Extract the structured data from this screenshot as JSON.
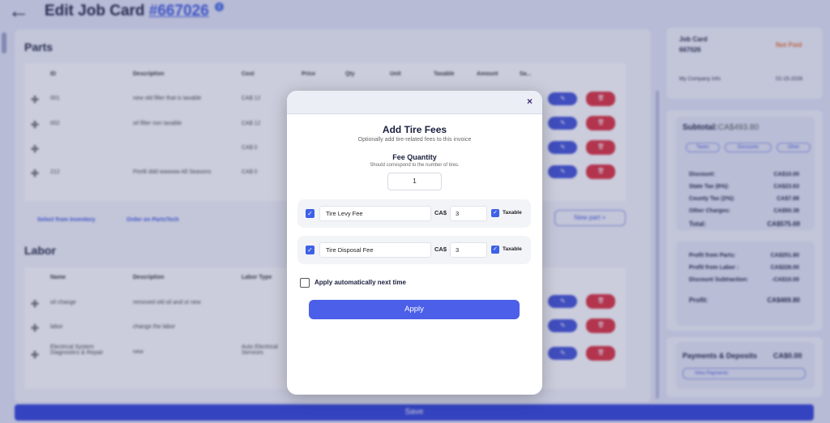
{
  "header": {
    "title": "Edit Job Card",
    "job_number": "#667026",
    "info_glyph": "i"
  },
  "parts": {
    "heading": "Parts",
    "columns": [
      "ID",
      "Description",
      "Cost",
      "Price",
      "Qty",
      "Unit",
      "Taxable",
      "Amount",
      "Sa..."
    ],
    "rows": [
      {
        "id": "001",
        "description": "new old filter that is taxable",
        "cost": "CA$ 12"
      },
      {
        "id": "002",
        "description": "oil filter non taxable",
        "cost": "CA$ 12"
      },
      {
        "id": "",
        "description": "",
        "cost": "CA$ 0"
      },
      {
        "id": "212",
        "description": "Pirelli ddd wwwww All Seasons",
        "cost": "CA$ 0"
      }
    ],
    "select_inventory": "Select from Inventory",
    "order_partstech": "Order on PartsTech",
    "new_part": "New part +"
  },
  "labor": {
    "heading": "Labor",
    "columns": [
      "Name",
      "Description",
      "Labor Type"
    ],
    "rows": [
      {
        "name": "oil change",
        "description": "removed old oil and ut new",
        "type": ""
      },
      {
        "name": "labor",
        "description": "change the labor",
        "type": ""
      },
      {
        "name": "Electrical System Diagnostics & Repair",
        "description": "new",
        "type": "Auto Electrical Services"
      }
    ]
  },
  "sidebar": {
    "job_card_label": "Job Card",
    "job_card_number": "667026",
    "status": "Not Paid",
    "company": "My Company Info",
    "date": "02-15-2026",
    "subtotal_label": "Subtotal:",
    "subtotal_value": "CA$493.80",
    "chips": [
      "Taxes",
      "Discounts",
      "Other"
    ],
    "lines": [
      {
        "label": "Discount:",
        "value": "CA$10.00"
      },
      {
        "label": "State Tax (6%):",
        "value": "CA$23.63"
      },
      {
        "label": "County Tax (2%):",
        "value": "CA$7.88"
      },
      {
        "label": "Other Charges:",
        "value": "CA$50.38"
      }
    ],
    "total_label": "Total:",
    "total_value": "CA$575.69",
    "profit_lines": [
      {
        "label": "Profit from Parts:",
        "value": "CA$251.80"
      },
      {
        "label": "Profit from Labor :",
        "value": "CA$228.00"
      },
      {
        "label": "Discount Subtraction:",
        "value": "-CA$10.00"
      }
    ],
    "profit_label": "Profit:",
    "profit_value": "CA$469.80",
    "payments_label": "Payments & Deposits",
    "payments_value": "CA$0.00",
    "view_payments": "View Payments"
  },
  "save_label": "Save",
  "modal": {
    "close_glyph": "×",
    "title": "Add Tire Fees",
    "subtitle": "Optionally add tire-related fees to this invoice",
    "fee_quantity_label": "Fee Quantity",
    "fee_quantity_hint": "Should correspond to the number of tires.",
    "fee_quantity_value": "1",
    "fees": [
      {
        "name": "Tire Levy Fee",
        "currency": "CA$",
        "amount": "3",
        "taxable_label": "Taxable",
        "checked": true,
        "taxable": true
      },
      {
        "name": "Tire Disposal Fee",
        "currency": "CA$",
        "amount": "3",
        "taxable_label": "Taxable",
        "checked": true,
        "taxable": true
      }
    ],
    "auto_apply_label": "Apply automatically next time",
    "apply_label": "Apply"
  },
  "colors": {
    "accent": "#4c5fe9",
    "danger": "#de2b3a",
    "not_paid": "#e8743b"
  }
}
